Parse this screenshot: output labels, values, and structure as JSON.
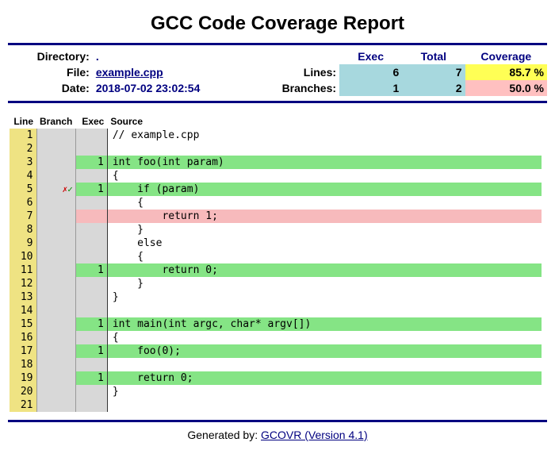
{
  "title": "GCC Code Coverage Report",
  "header": {
    "labels": {
      "directory": "Directory:",
      "file": "File:",
      "date": "Date:",
      "lines": "Lines:",
      "branches": "Branches:"
    },
    "directory_value": ".",
    "file_value": "example.cpp",
    "date_value": "2018-07-02 23:02:54",
    "stat_headers": {
      "exec": "Exec",
      "total": "Total",
      "coverage": "Coverage"
    },
    "lines": {
      "exec": "6",
      "total": "7",
      "coverage": "85.7 %"
    },
    "branches": {
      "exec": "1",
      "total": "2",
      "coverage": "50.0 %"
    }
  },
  "columns": {
    "line": "Line",
    "branch": "Branch",
    "exec": "Exec",
    "source": "Source"
  },
  "branch_marks": {
    "fail": "✗",
    "pass": "✓"
  },
  "rows": [
    {
      "n": "1",
      "branch": "",
      "exec": "",
      "exec_bg": "",
      "src": "// example.cpp",
      "src_bg": ""
    },
    {
      "n": "2",
      "branch": "",
      "exec": "",
      "exec_bg": "",
      "src": "",
      "src_bg": ""
    },
    {
      "n": "3",
      "branch": "",
      "exec": "1",
      "exec_bg": "bg-green",
      "src": "int foo(int param)",
      "src_bg": "bg-green"
    },
    {
      "n": "4",
      "branch": "",
      "exec": "",
      "exec_bg": "",
      "src": "{",
      "src_bg": ""
    },
    {
      "n": "5",
      "branch": "xc",
      "exec": "1",
      "exec_bg": "bg-green",
      "src": "    if (param)",
      "src_bg": "bg-green"
    },
    {
      "n": "6",
      "branch": "",
      "exec": "",
      "exec_bg": "",
      "src": "    {",
      "src_bg": ""
    },
    {
      "n": "7",
      "branch": "",
      "exec": "",
      "exec_bg": "bg-red",
      "src": "        return 1;",
      "src_bg": "bg-red"
    },
    {
      "n": "8",
      "branch": "",
      "exec": "",
      "exec_bg": "",
      "src": "    }",
      "src_bg": ""
    },
    {
      "n": "9",
      "branch": "",
      "exec": "",
      "exec_bg": "",
      "src": "    else",
      "src_bg": ""
    },
    {
      "n": "10",
      "branch": "",
      "exec": "",
      "exec_bg": "",
      "src": "    {",
      "src_bg": ""
    },
    {
      "n": "11",
      "branch": "",
      "exec": "1",
      "exec_bg": "bg-green",
      "src": "        return 0;",
      "src_bg": "bg-green"
    },
    {
      "n": "12",
      "branch": "",
      "exec": "",
      "exec_bg": "",
      "src": "    }",
      "src_bg": ""
    },
    {
      "n": "13",
      "branch": "",
      "exec": "",
      "exec_bg": "",
      "src": "}",
      "src_bg": ""
    },
    {
      "n": "14",
      "branch": "",
      "exec": "",
      "exec_bg": "",
      "src": "",
      "src_bg": ""
    },
    {
      "n": "15",
      "branch": "",
      "exec": "1",
      "exec_bg": "bg-green",
      "src": "int main(int argc, char* argv[])",
      "src_bg": "bg-green"
    },
    {
      "n": "16",
      "branch": "",
      "exec": "",
      "exec_bg": "",
      "src": "{",
      "src_bg": ""
    },
    {
      "n": "17",
      "branch": "",
      "exec": "1",
      "exec_bg": "bg-green",
      "src": "    foo(0);",
      "src_bg": "bg-green"
    },
    {
      "n": "18",
      "branch": "",
      "exec": "",
      "exec_bg": "",
      "src": "",
      "src_bg": ""
    },
    {
      "n": "19",
      "branch": "",
      "exec": "1",
      "exec_bg": "bg-green",
      "src": "    return 0;",
      "src_bg": "bg-green"
    },
    {
      "n": "20",
      "branch": "",
      "exec": "",
      "exec_bg": "",
      "src": "}",
      "src_bg": ""
    },
    {
      "n": "21",
      "branch": "",
      "exec": "",
      "exec_bg": "",
      "src": "",
      "src_bg": ""
    }
  ],
  "footer": {
    "prefix": "Generated by: ",
    "link_text": "GCOVR (Version 4.1)"
  }
}
